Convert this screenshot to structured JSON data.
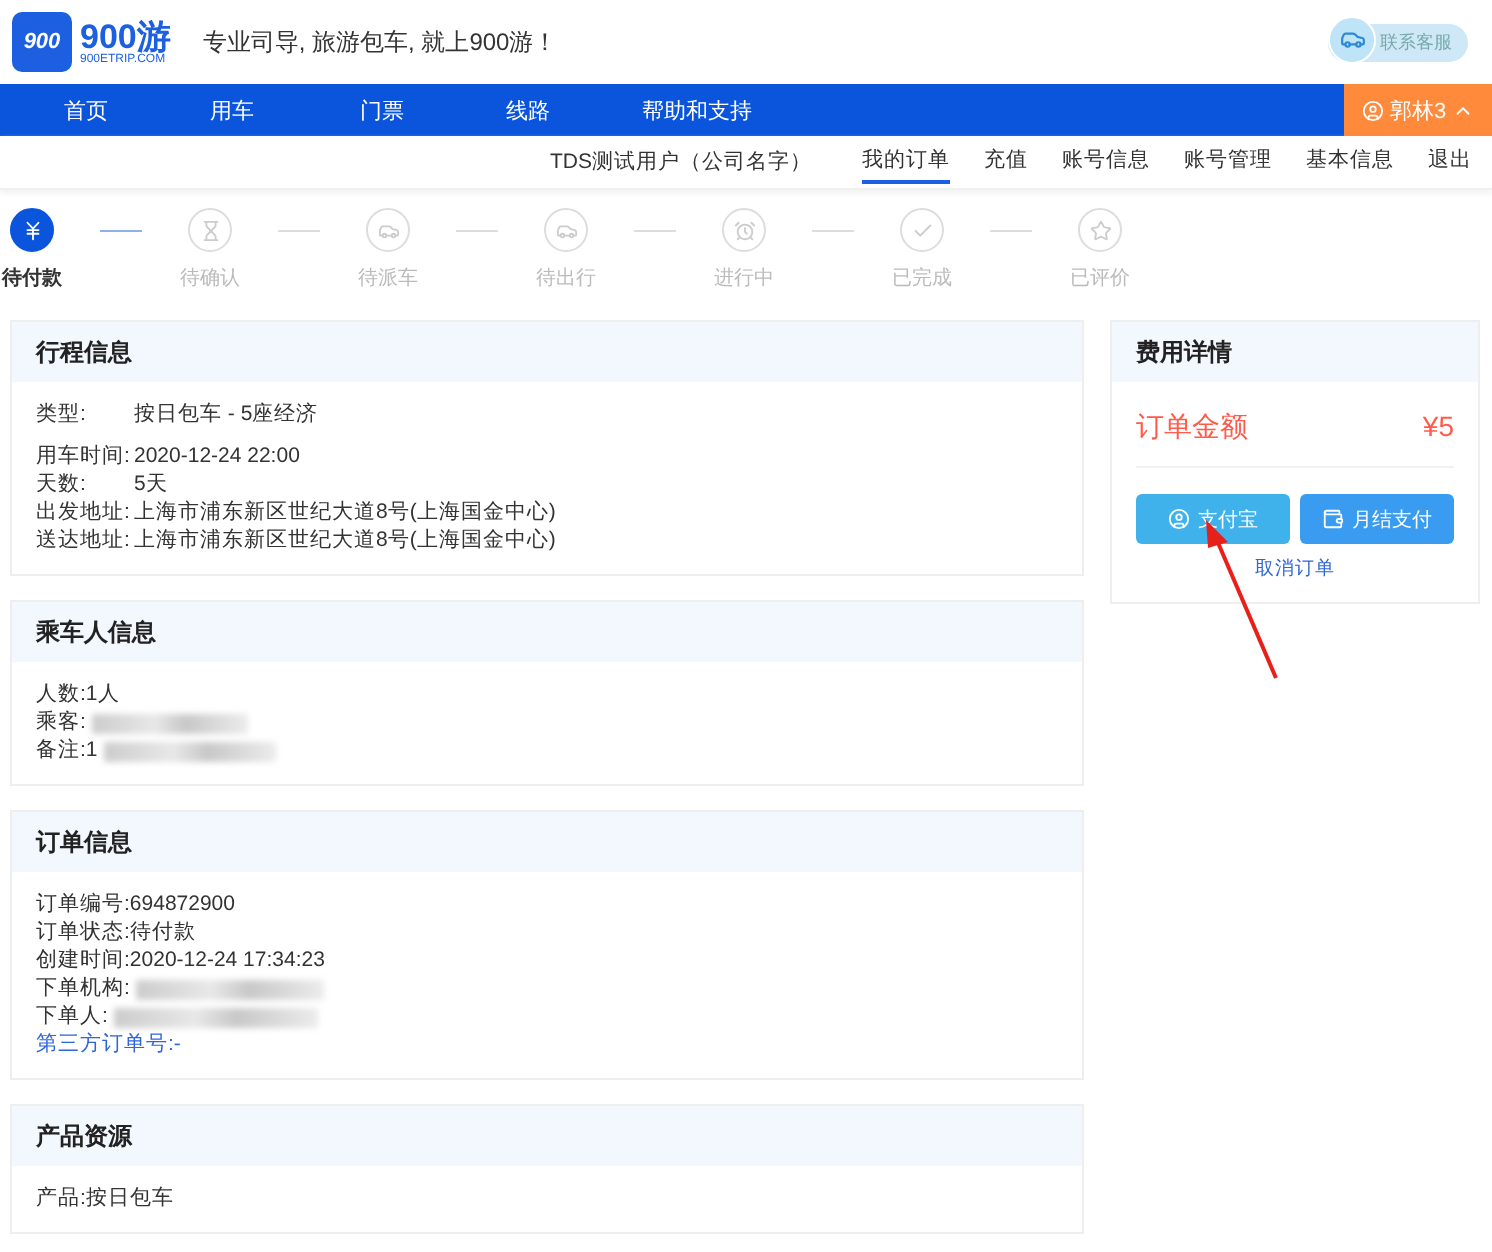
{
  "header": {
    "logo_mark": "900",
    "logo_name": "900游",
    "logo_domain": "900ETRIP.COM",
    "slogan": "专业司导, 旅游包车, 就上900游！",
    "support": "联系客服"
  },
  "nav": {
    "items": [
      {
        "label": "首页",
        "selected": false
      },
      {
        "label": "用车",
        "selected": false
      },
      {
        "label": "门票",
        "selected": false
      },
      {
        "label": "线路",
        "selected": false
      },
      {
        "label": "帮助和支持",
        "selected": false
      }
    ],
    "user": "郭林3"
  },
  "subnav": {
    "account": "TDS测试用户（公司名字）",
    "links": [
      {
        "label": "我的订单",
        "selected": true
      },
      {
        "label": "充值",
        "selected": false
      },
      {
        "label": "账号信息",
        "selected": false
      },
      {
        "label": "账号管理",
        "selected": false
      },
      {
        "label": "基本信息",
        "selected": false
      },
      {
        "label": "退出",
        "selected": false
      }
    ]
  },
  "steps": [
    {
      "label": "待付款",
      "kind": "yen",
      "selected": true
    },
    {
      "label": "待确认",
      "kind": "hourglass",
      "selected": false
    },
    {
      "label": "待派车",
      "kind": "car",
      "selected": false
    },
    {
      "label": "待出行",
      "kind": "car",
      "selected": false
    },
    {
      "label": "进行中",
      "kind": "clock",
      "selected": false
    },
    {
      "label": "已完成",
      "kind": "check",
      "selected": false
    },
    {
      "label": "已评价",
      "kind": "star",
      "selected": false
    }
  ],
  "sections": [
    {
      "title": "行程信息",
      "kind": "aligned",
      "groups": [
        [
          {
            "label": "类型:",
            "value": "按日包车 - 5座经济"
          }
        ],
        [
          {
            "label": "用车时间:",
            "value": "2020-12-24 22:00"
          },
          {
            "label": "天数:",
            "value": "5天"
          },
          {
            "label": "出发地址:",
            "value": "上海市浦东新区世纪大道8号(上海国金中心)"
          },
          {
            "label": "送达地址:",
            "value": "上海市浦东新区世纪大道8号(上海国金中心)"
          }
        ]
      ]
    },
    {
      "title": "乘车人信息",
      "kind": "inline",
      "groups": [
        [
          {
            "label": "人数:",
            "value": "1人"
          },
          {
            "label": "乘客:",
            "redacted": true
          },
          {
            "label": "备注:",
            "value": "1",
            "redacted": true
          }
        ]
      ]
    },
    {
      "title": "订单信息",
      "kind": "inline",
      "groups": [
        [
          {
            "label": "订单编号:",
            "value": "694872900"
          },
          {
            "label": "订单状态:",
            "value": "待付款"
          },
          {
            "label": "创建时间:",
            "value": "2020-12-24 17:34:23"
          },
          {
            "label": "下单机构:",
            "redacted": true
          },
          {
            "label": "下单人:",
            "redacted": true
          },
          {
            "label": "第三方订单号:",
            "value": "-",
            "kind": "link"
          }
        ]
      ]
    },
    {
      "title": "产品资源",
      "kind": "inline",
      "groups": [
        [
          {
            "label": "产品:",
            "value": "按日包车"
          }
        ]
      ]
    }
  ],
  "fees": {
    "title": "费用详情",
    "amount_label": "订单金额",
    "amount": "¥5",
    "buttons": [
      {
        "label": "支付宝",
        "kind": "alipay"
      },
      {
        "label": "月结支付",
        "kind": "wallet"
      }
    ],
    "cancel": "取消订单"
  }
}
